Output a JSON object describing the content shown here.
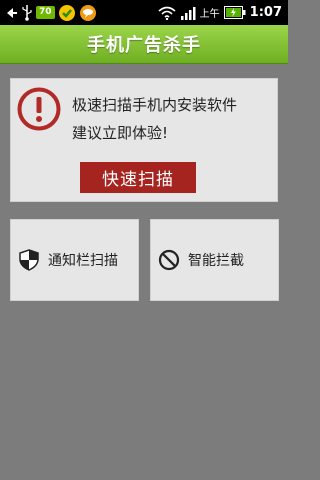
{
  "status_bar": {
    "battery_percent": "70",
    "ampm": "上午",
    "time": "1:07",
    "icons": [
      "back-icon",
      "usb-icon",
      "battery-badge",
      "app-notification-icon",
      "chat-notification-icon",
      "wifi-icon",
      "signal-icon",
      "battery-charging-icon"
    ]
  },
  "header": {
    "title": "手机广告杀手"
  },
  "alert": {
    "icon": "exclamation-icon",
    "line1": "极速扫描手机内安装软件",
    "line2": "建议立即体验!",
    "button_label": "快速扫描"
  },
  "tiles": [
    {
      "label": "通知栏扫描",
      "icon": "shield-icon"
    },
    {
      "label": "智能拦截",
      "icon": "block-icon"
    }
  ],
  "colors": {
    "title_bar": "#7fc131",
    "scan_button": "#a52420",
    "alert_icon": "#b22a27",
    "background": "#7c7c7c",
    "card": "#e6e6e6"
  }
}
